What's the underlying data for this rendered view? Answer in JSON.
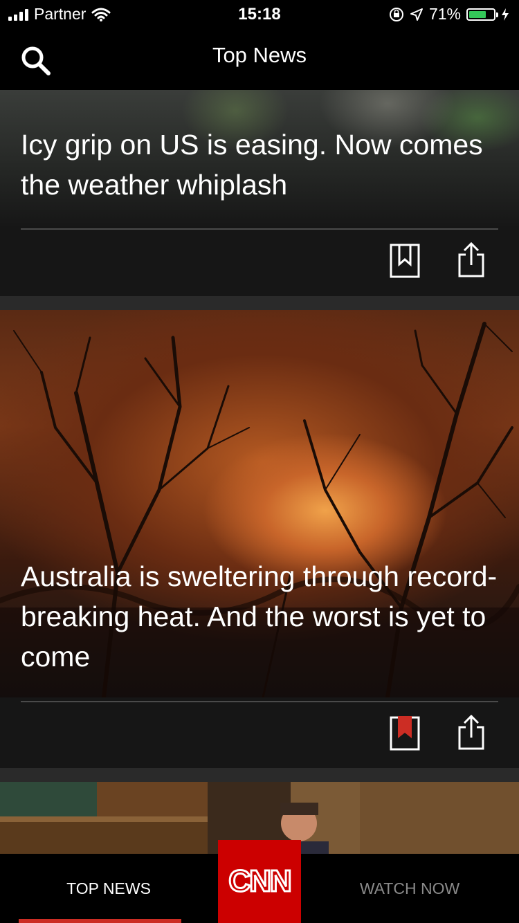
{
  "status_bar": {
    "carrier": "Partner",
    "time": "15:18",
    "battery_percent": "71%",
    "battery_level": 0.71,
    "battery_color": "#34c759"
  },
  "nav": {
    "title": "Top News",
    "search_icon": "search-icon"
  },
  "articles": [
    {
      "headline": "Icy grip on US is easing. Now comes the weather whiplash",
      "bookmarked": false,
      "bookmark_icon": "bookmark-outline-icon",
      "share_icon": "share-icon"
    },
    {
      "headline": "Australia is sweltering through record-breaking heat. And the worst is yet to come",
      "bookmarked": true,
      "bookmark_icon": "bookmark-filled-icon",
      "share_icon": "share-icon"
    }
  ],
  "tab_bar": {
    "tabs": [
      {
        "label": "TOP NEWS",
        "active": true
      },
      {
        "label": "WATCH NOW",
        "active": false
      }
    ],
    "logo": "CNN",
    "accent_color": "#cc2d24"
  }
}
